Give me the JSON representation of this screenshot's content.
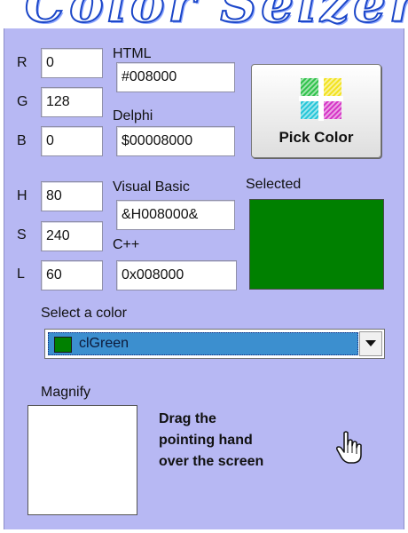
{
  "app": {
    "title": "Color Seizer"
  },
  "rgb": {
    "r": {
      "label": "R",
      "value": "0"
    },
    "g": {
      "label": "G",
      "value": "128"
    },
    "b": {
      "label": "B",
      "value": "0"
    }
  },
  "hsl": {
    "h": {
      "label": "H",
      "value": "80"
    },
    "s": {
      "label": "S",
      "value": "240"
    },
    "l": {
      "label": "L",
      "value": "60"
    }
  },
  "codes": {
    "html": {
      "label": "HTML",
      "value": "#008000"
    },
    "delphi": {
      "label": "Delphi",
      "value": "$00008000"
    },
    "vb": {
      "label": "Visual Basic",
      "value": "&H008000&"
    },
    "cpp": {
      "label": "C++",
      "value": "0x008000"
    }
  },
  "pick_button": {
    "label": "Pick Color",
    "icon": "color-picker-icon"
  },
  "selected": {
    "label": "Selected",
    "color": "#008000"
  },
  "color_select": {
    "label": "Select a color",
    "value": "clGreen",
    "swatch": "#008000",
    "dropdown_icon": "chevron-down-icon"
  },
  "magnify": {
    "label": "Magnify"
  },
  "instructions": {
    "line1": "Drag the",
    "line2": "pointing hand",
    "line3": "over the screen"
  },
  "colors": {
    "panel": "#b7b8f3",
    "accent": "#3c8fcf",
    "title": "#1b46c8"
  }
}
